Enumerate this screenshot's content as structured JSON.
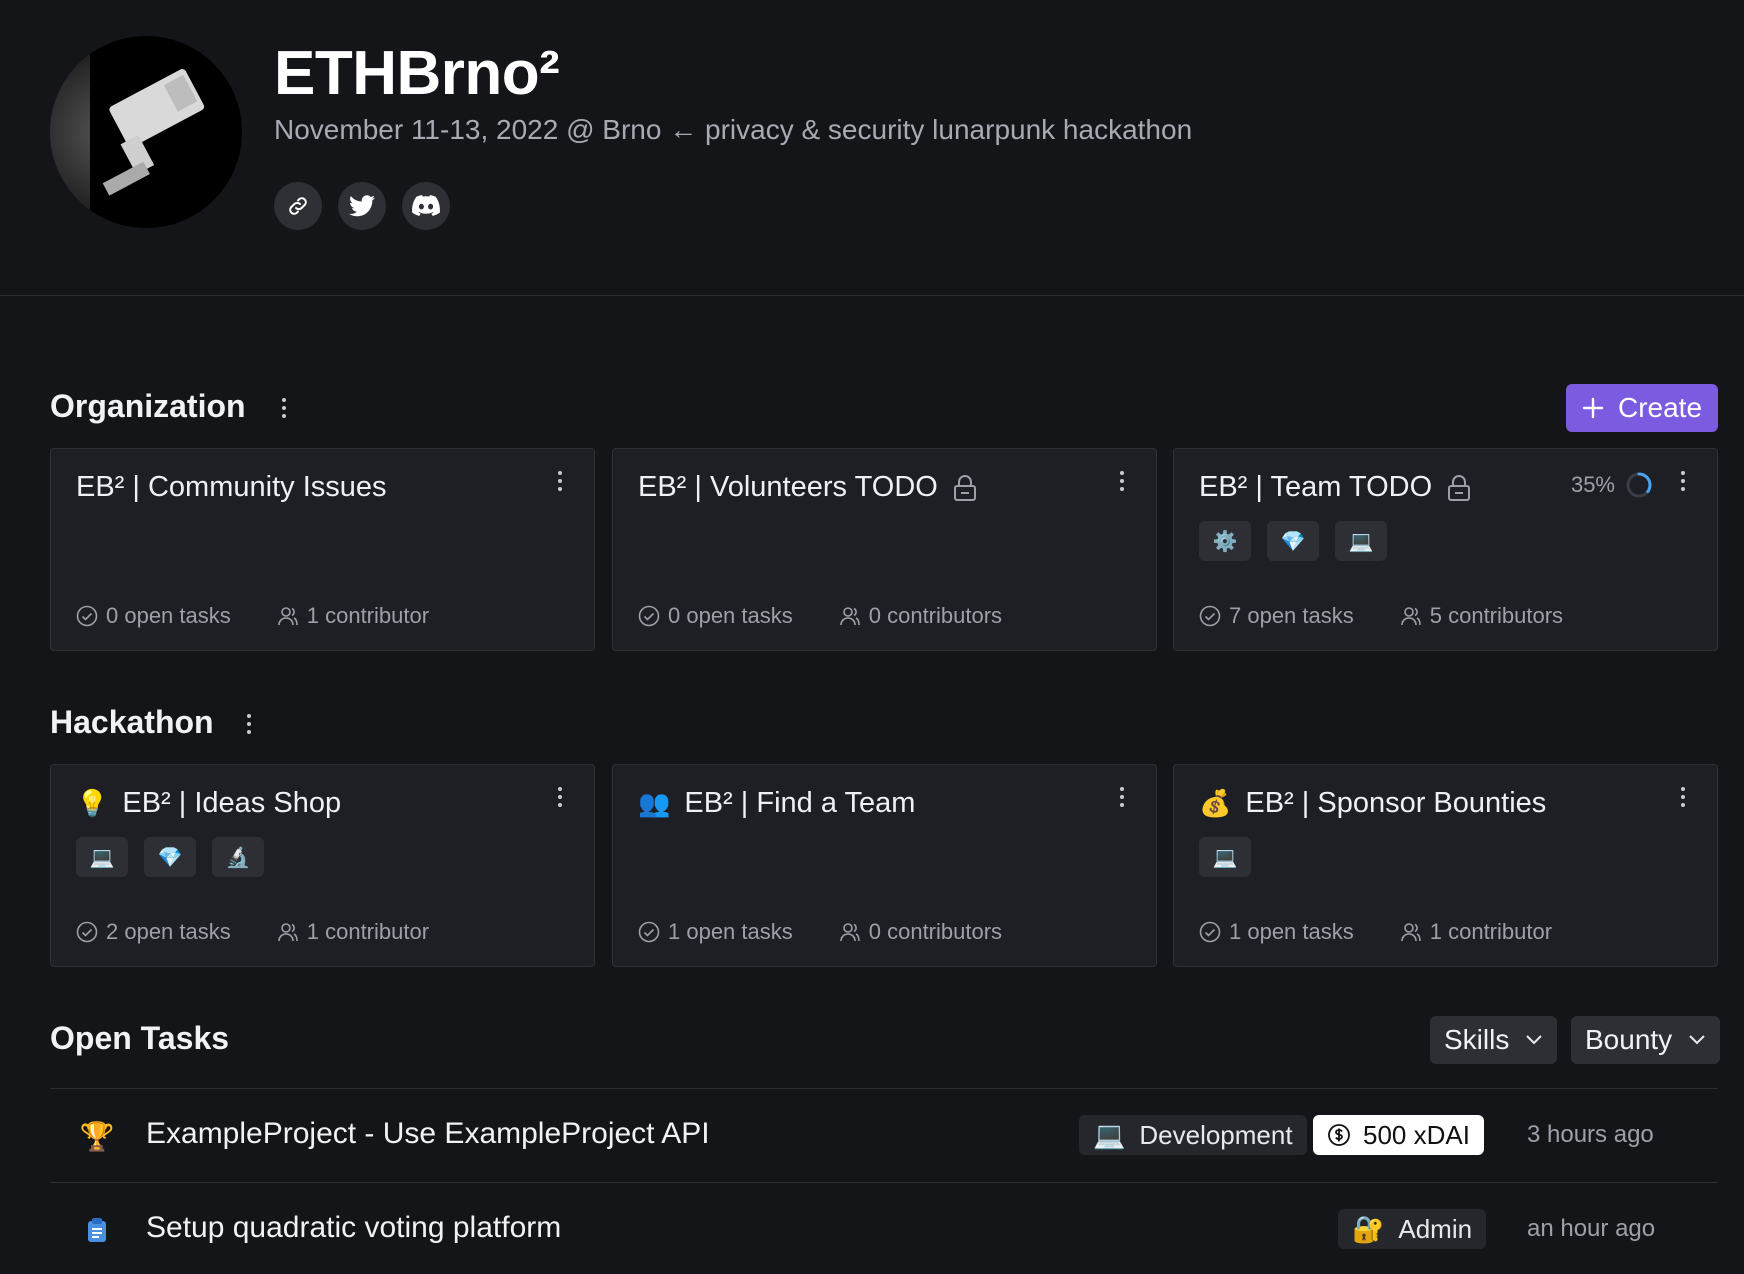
{
  "header": {
    "title": "ETHBrno²",
    "subtitle": "November 11-13, 2022 @ Brno ← privacy & security lunarpunk hackathon",
    "social": [
      "link-icon",
      "twitter-icon",
      "discord-icon"
    ]
  },
  "organization": {
    "title": "Organization",
    "create_label": "Create",
    "cards": [
      {
        "title": "EB² | Community Issues",
        "locked": false,
        "open_tasks": "0 open tasks",
        "contributors": "1 contributor",
        "tags": []
      },
      {
        "title": "EB² | Volunteers TODO",
        "locked": true,
        "open_tasks": "0 open tasks",
        "contributors": "0 contributors",
        "tags": []
      },
      {
        "title": "EB² | Team TODO",
        "locked": true,
        "progress": "35%",
        "progress_fraction": 0.35,
        "open_tasks": "7 open tasks",
        "contributors": "5 contributors",
        "tags": [
          "⚙️",
          "💎",
          "💻"
        ]
      }
    ]
  },
  "hackathon": {
    "title": "Hackathon",
    "cards": [
      {
        "emoji": "💡",
        "title": "EB² | Ideas Shop",
        "open_tasks": "2 open tasks",
        "contributors": "1 contributor",
        "tags": [
          "💻",
          "💎",
          "🔬"
        ]
      },
      {
        "emoji": "👥",
        "title": "EB² | Find a Team",
        "open_tasks": "1 open tasks",
        "contributors": "0 contributors",
        "tags": []
      },
      {
        "emoji": "💰",
        "title": "EB² | Sponsor Bounties",
        "open_tasks": "1 open tasks",
        "contributors": "1 contributor",
        "tags": [
          "💻"
        ]
      }
    ]
  },
  "open_tasks": {
    "title": "Open Tasks",
    "filters": {
      "skills": "Skills",
      "bounty": "Bounty"
    },
    "tasks": [
      {
        "icon": "🏆",
        "title": "ExampleProject - Use ExampleProject API",
        "tag_emoji": "💻",
        "tag": "Development",
        "bounty": "500 xDAI",
        "time": "3 hours ago"
      },
      {
        "icon": "📋",
        "title": "Setup quadratic voting platform",
        "tag_emoji": "🔐",
        "tag": "Admin",
        "time": "an hour ago"
      }
    ]
  },
  "colors": {
    "accent": "#7b5ce0",
    "background": "#141518",
    "card": "#1d1f24"
  }
}
